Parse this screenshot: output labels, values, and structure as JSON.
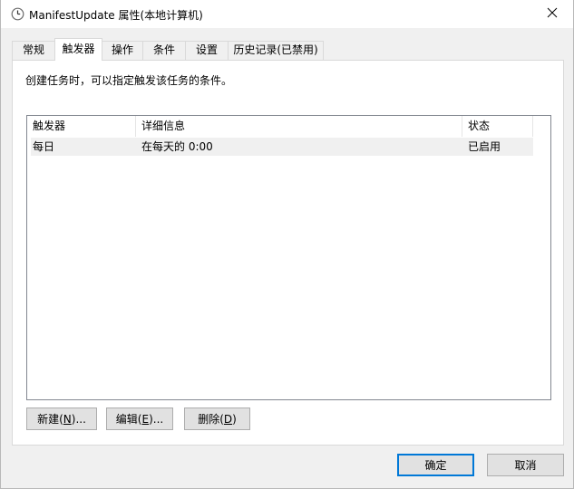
{
  "window": {
    "title": "ManifestUpdate 属性(本地计算机)",
    "icon": "clock-icon",
    "close_icon": "close-icon"
  },
  "tabs": [
    {
      "label": "常规"
    },
    {
      "label": "触发器",
      "active": true
    },
    {
      "label": "操作"
    },
    {
      "label": "条件"
    },
    {
      "label": "设置"
    },
    {
      "label": "历史记录(已禁用)"
    }
  ],
  "panel": {
    "description": "创建任务时，可以指定触发该任务的条件。",
    "columns": [
      "触发器",
      "详细信息",
      "状态"
    ],
    "rows": [
      {
        "trigger": "每日",
        "details": "在每天的 0:00",
        "status": "已启用"
      }
    ],
    "buttons": {
      "new": {
        "label": "新建(",
        "key": "N",
        "suffix": ")..."
      },
      "edit": {
        "label": "编辑(",
        "key": "E",
        "suffix": ")..."
      },
      "delete": {
        "label": "删除(",
        "key": "D",
        "suffix": ")"
      }
    }
  },
  "footer": {
    "ok": "确定",
    "cancel": "取消"
  },
  "colors": {
    "accent": "#0078d7",
    "dialog_bg": "#f0f0f0",
    "selected_row": "#f0f0f0"
  }
}
